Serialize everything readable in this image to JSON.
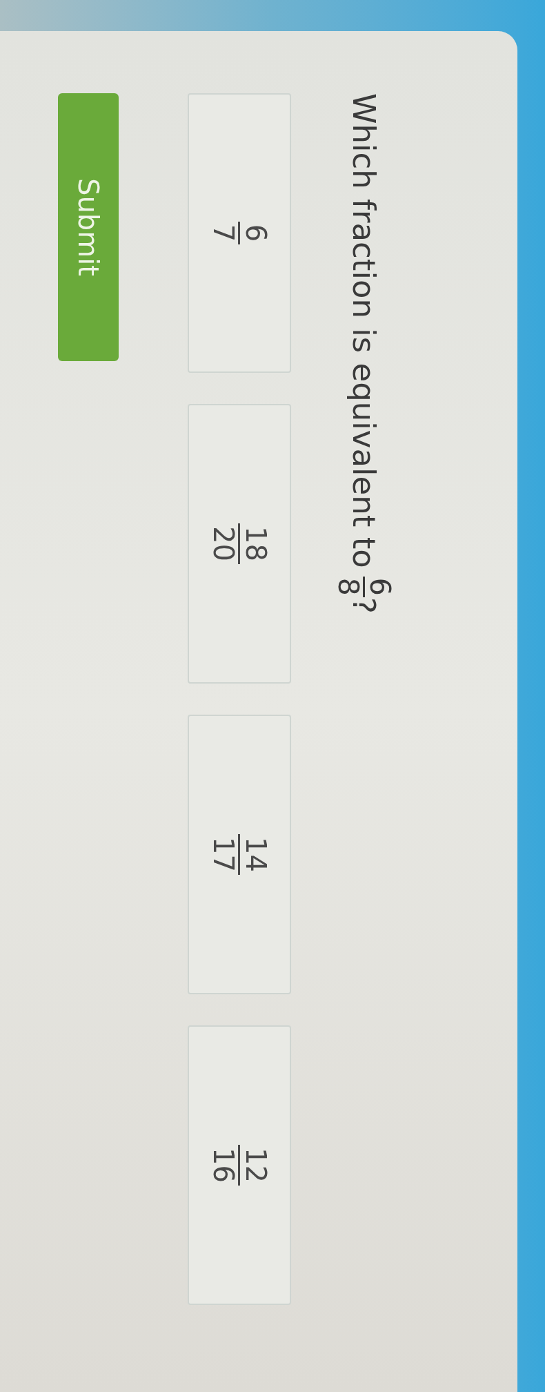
{
  "question": {
    "text": "Which fraction is equivalent to",
    "fraction": {
      "numerator": "6",
      "denominator": "8"
    },
    "suffix": "?"
  },
  "options": [
    {
      "numerator": "6",
      "denominator": "7",
      "selected": false
    },
    {
      "numerator": "18",
      "denominator": "20",
      "selected": false
    },
    {
      "numerator": "14",
      "denominator": "17",
      "selected": false
    },
    {
      "numerator": "12",
      "denominator": "16",
      "selected": false
    }
  ],
  "submit_button": {
    "label": "Submit"
  }
}
